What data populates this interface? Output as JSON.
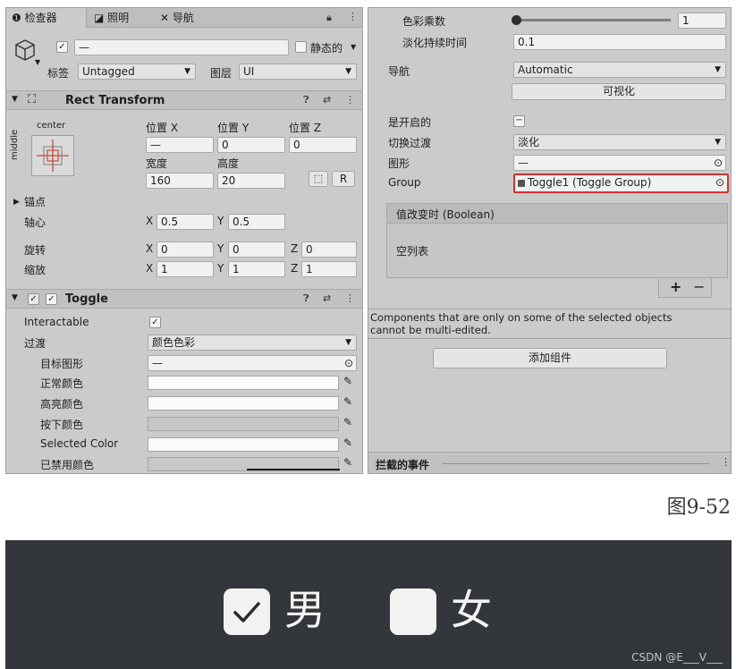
{
  "tabs": {
    "inspector": "检查器",
    "lighting": "照明",
    "navigation": "导航"
  },
  "object": {
    "name_value": "—",
    "static_label": "静态的",
    "tag_label": "标签",
    "tag_value": "Untagged",
    "layer_label": "图层",
    "layer_value": "UI"
  },
  "rect_transform": {
    "title": "Rect Transform",
    "anchor_preset_top": "center",
    "anchor_preset_side": "middle",
    "pos_x_label": "位置 X",
    "pos_y_label": "位置 Y",
    "pos_z_label": "位置 Z",
    "pos_x_value": "—",
    "pos_y_value": "0",
    "pos_z_value": "0",
    "width_label": "宽度",
    "height_label": "高度",
    "width_value": "160",
    "height_value": "20",
    "r_button": "R",
    "anchors_label": "锚点",
    "pivot_label": "轴心",
    "pivot_x": "0.5",
    "pivot_y": "0.5",
    "rotation_label": "旋转",
    "rot_x": "0",
    "rot_y": "0",
    "rot_z": "0",
    "scale_label": "缩放",
    "scale_x": "1",
    "scale_y": "1",
    "scale_z": "1",
    "x": "X",
    "y": "Y",
    "z": "Z"
  },
  "toggle": {
    "title": "Toggle",
    "interactable_label": "Interactable",
    "transition_label": "过渡",
    "transition_value": "颜色色彩",
    "target_graphic_label": "目标图形",
    "target_graphic_value": "—",
    "normal_color_label": "正常颜色",
    "highlighted_color_label": "高亮颜色",
    "pressed_color_label": "按下颜色",
    "selected_color_label": "Selected Color",
    "disabled_color_label": "已禁用颜色"
  },
  "right": {
    "color_multiplier_label": "色彩乘数",
    "color_multiplier_value": "1",
    "fade_duration_label": "淡化持续时间",
    "fade_duration_value": "0.1",
    "navigation_label": "导航",
    "navigation_value": "Automatic",
    "visualize_button": "可视化",
    "is_on_label": "是开启的",
    "toggle_transition_label": "切换过渡",
    "toggle_transition_value": "淡化",
    "graphic_label": "图形",
    "graphic_value": "—",
    "group_label": "Group",
    "group_value": "Toggle1 (Toggle Group)",
    "event_header": "值改变时 (Boolean)",
    "event_empty": "空列表",
    "plus": "+",
    "minus": "−",
    "multi_edit_note_line1": "Components that are only on some of the selected objects",
    "multi_edit_note_line2": "cannot be multi-edited.",
    "add_component_button": "添加组件",
    "intercepted_events_label": "拦截的事件"
  },
  "caption": "图9-52",
  "preview": {
    "male_label": "男",
    "female_label": "女",
    "male_checked": true,
    "female_checked": false
  },
  "watermark": "CSDN @E___V___",
  "colors": {
    "panel_bg": "#c9cccb",
    "highlight_border": "#d2312f",
    "preview_bg": "#33363a"
  }
}
